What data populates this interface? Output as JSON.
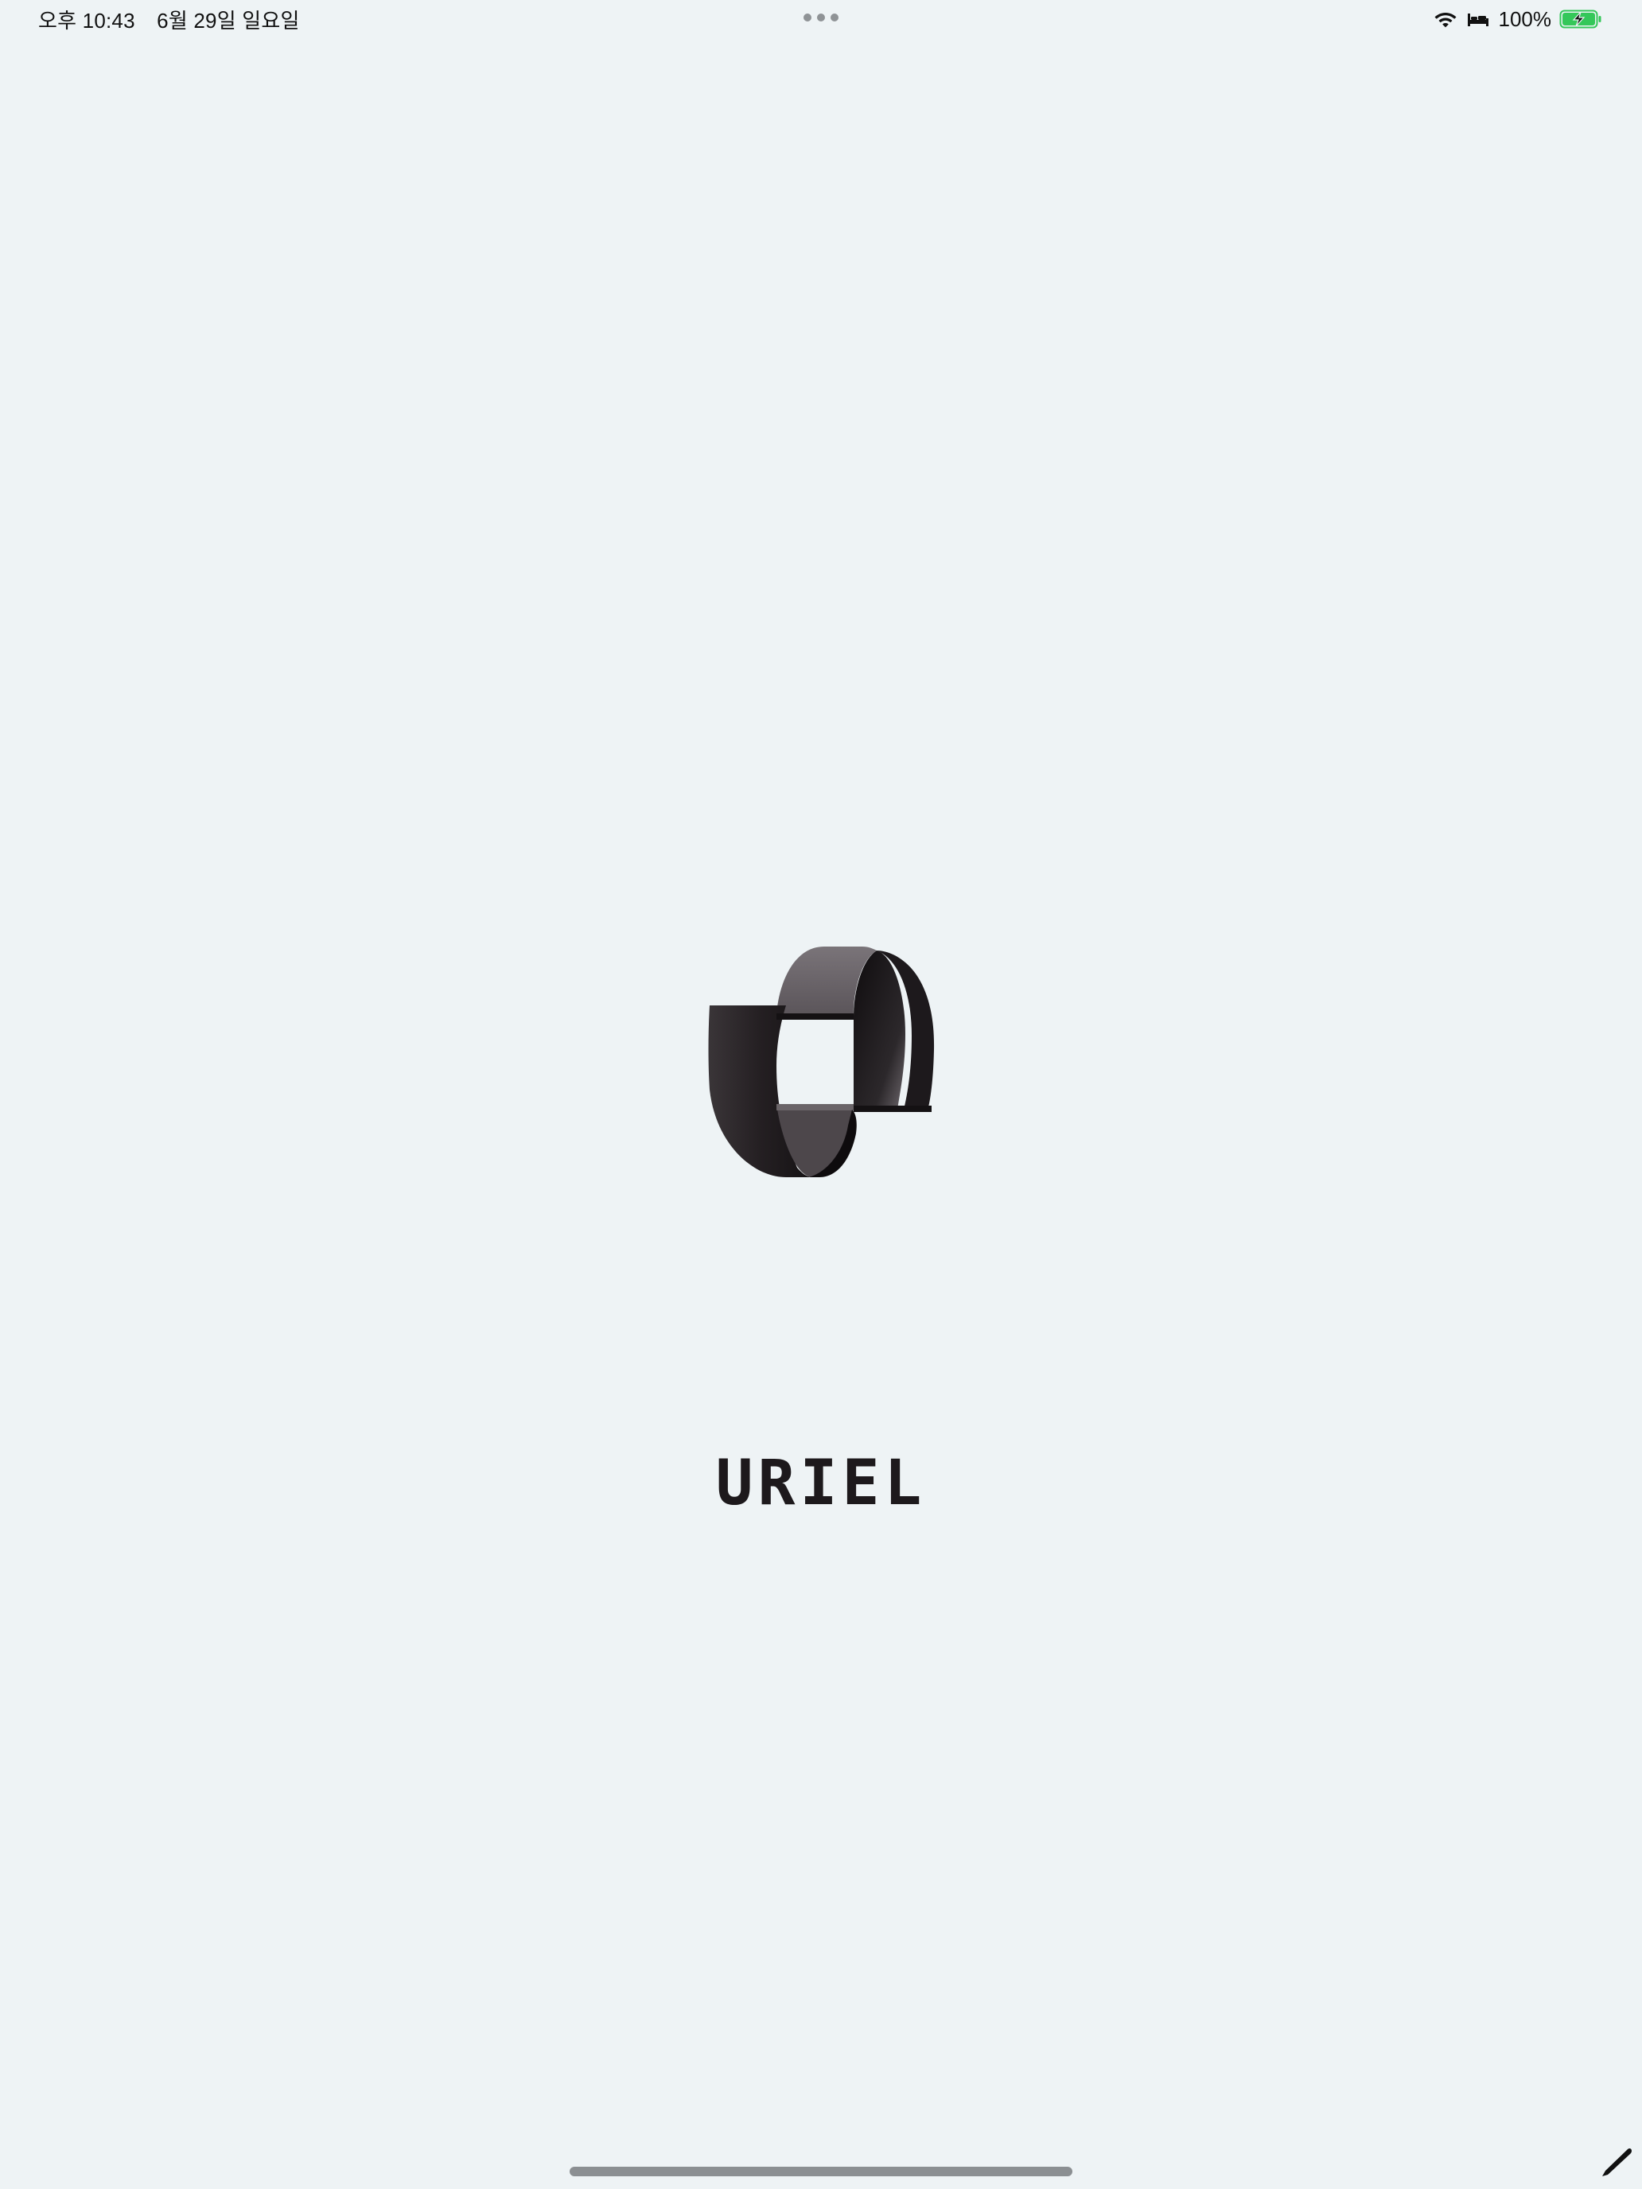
{
  "status_bar": {
    "time": "오후 10:43",
    "date": "6월 29일 일요일",
    "battery_percent": "100%",
    "battery_level": 1.0,
    "charging": true,
    "icons": [
      "wifi-icon",
      "bed-icon",
      "battery-icon"
    ]
  },
  "multitask": {
    "icon": "more-dots-icon"
  },
  "splash": {
    "logo_icon": "uriel-logo-icon",
    "brand_name": "URIEL"
  },
  "colors": {
    "background": "#eef3f5",
    "logo_dark": "#1d191c",
    "logo_light": "#6c666b",
    "battery_green": "#34c759"
  },
  "home_indicator": {
    "icon": "home-indicator"
  },
  "pencil": {
    "icon": "pencil-icon"
  }
}
